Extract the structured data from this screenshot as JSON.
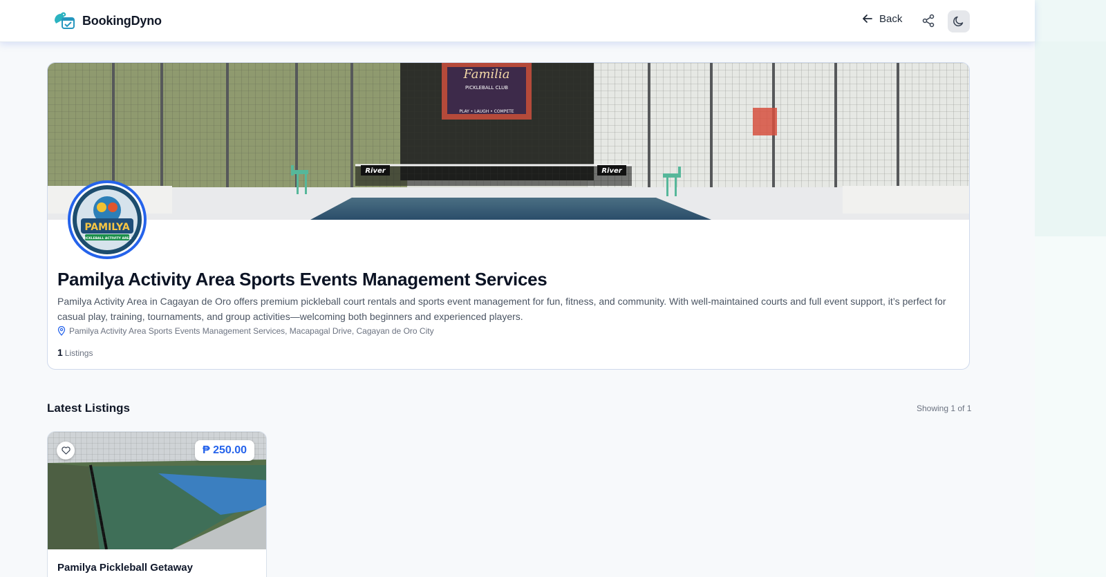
{
  "app": {
    "name": "BookingDyno"
  },
  "header": {
    "back_label": "Back"
  },
  "profile": {
    "title": "Pamilya Activity Area Sports Events Management Services",
    "description": "Pamilya Activity Area in Cagayan de Oro offers premium pickleball court rentals and sports event management for fun, fitness, and community. With well-maintained courts and full event support, it’s perfect for casual play, training, tournaments, and group activities—welcoming both beginners and experienced players.",
    "location": "Pamilya Activity Area Sports Events Management Services, Macapagal Drive, Cagayan de Oro City",
    "listing_count": "1",
    "listing_count_label": "Listings",
    "cover_banner": {
      "main_text": "Familia",
      "sub_text": "PICKLEBALL CLUB",
      "tagline": "PLAY • LAUGH • COMPETE",
      "net_brand": "River"
    },
    "logo": {
      "main": "PAMILYA",
      "sub": "PICKLEBALL ACTIVITY AREA"
    }
  },
  "listings_section": {
    "title": "Latest Listings",
    "count_text": "Showing 1 of 1",
    "items": [
      {
        "title": "Pamilya Pickleball Getaway",
        "price": "₱ 250.00"
      }
    ]
  },
  "icons": {
    "logo": "dino-calendar-icon",
    "back": "arrow-left-icon",
    "share": "share-icon",
    "theme": "moon-icon",
    "location": "map-pin-icon",
    "favorite": "heart-icon"
  },
  "colors": {
    "accent": "#2563eb",
    "text": "#0f172a",
    "muted": "#6b7280"
  }
}
